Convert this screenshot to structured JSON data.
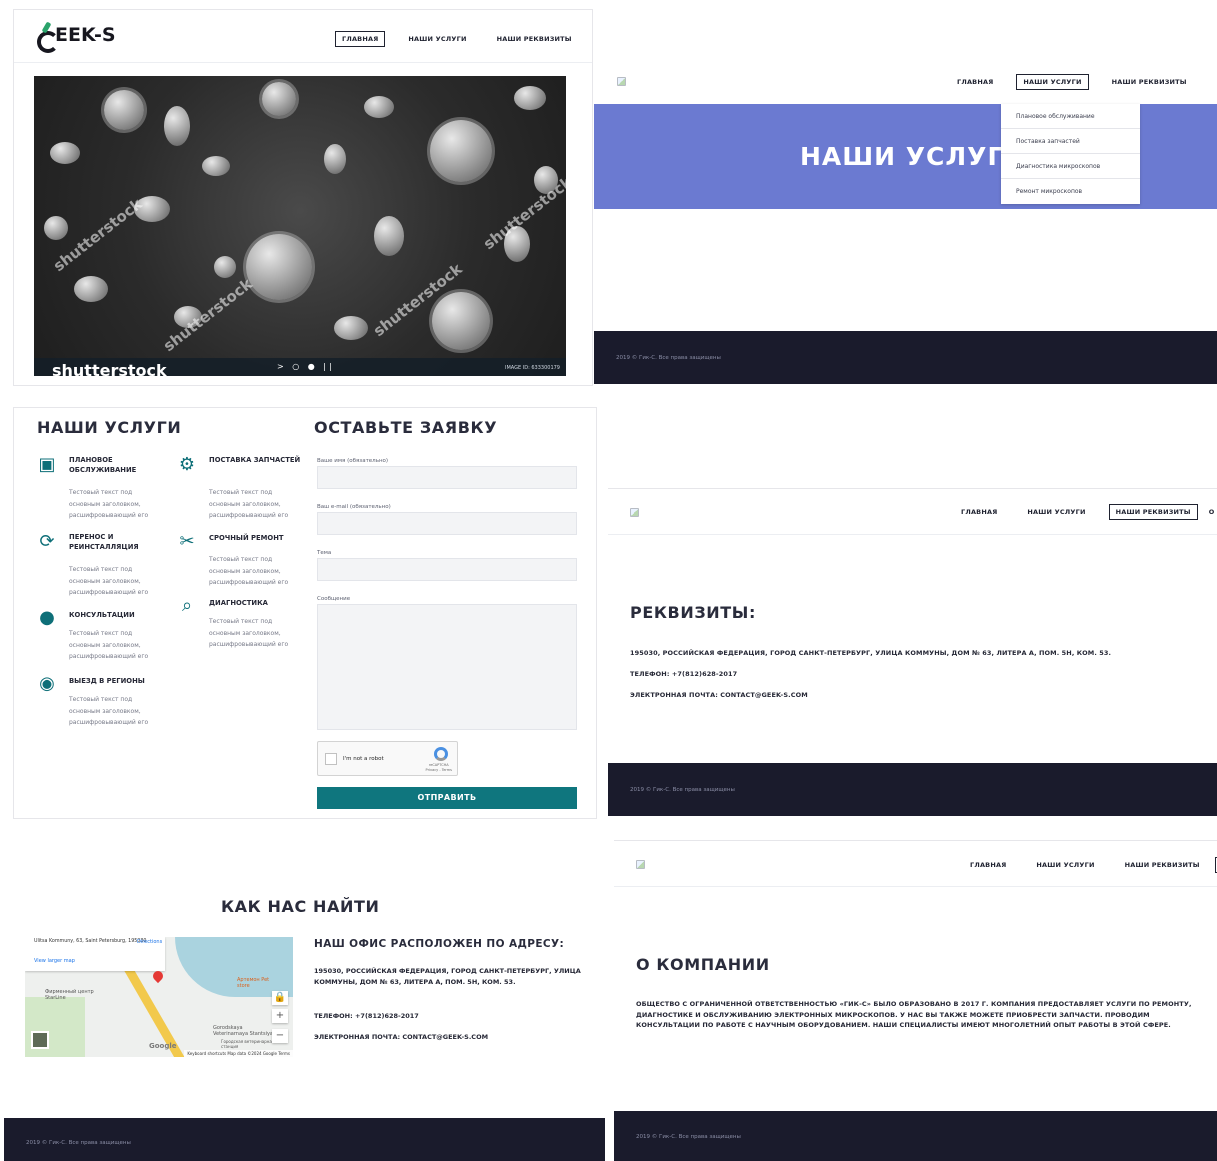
{
  "nav": {
    "home": "ГЛАВНАЯ",
    "services": "НАШИ УСЛУГИ",
    "requisites": "НАШИ РЕКВИЗИТЫ",
    "about": "О НАС"
  },
  "logo": {
    "text": "EEK-S"
  },
  "hero": {
    "watermark": "shutterstock",
    "image_id": "IMAGE ID: 633300179",
    "dots": "> ○ ● ||"
  },
  "services_page": {
    "banner_title": "НАШИ УСЛУГИ",
    "dropdown": [
      "Плановое обслуживание",
      "Поставка запчастей",
      "Диагностика микроскопов",
      "Ремонт микроскопов"
    ]
  },
  "footer": {
    "copyright": "2019 © Гик-С. Все права защищены"
  },
  "services_section": {
    "title": "НАШИ УСЛУГИ",
    "items": [
      {
        "title": "Плановое обслуживание",
        "icon": "calendar-icon",
        "desc": "Тестовый текст под основным заголовком, расшифровывающий его"
      },
      {
        "title": "Поставка запчастей",
        "icon": "gears-icon",
        "desc": "Тестовый текст под основным заголовком, расшифровывающий его"
      },
      {
        "title": "Перенос и реинсталляция",
        "icon": "sync-icon",
        "desc": "Тестовый текст под основным заголовком, расшифровывающий его"
      },
      {
        "title": "Срочный ремонт",
        "icon": "tools-icon",
        "desc": "Тестовый текст под основным заголовком, расшифровывающий его"
      },
      {
        "title": "Консультации",
        "icon": "users-icon",
        "desc": "Тестовый текст под основным заголовком, расшифровывающий его"
      },
      {
        "title": "Диагностика",
        "icon": "search-icon",
        "desc": "Тестовый текст под основным заголовком, расшифровывающий его"
      },
      {
        "title": "Выезд в регионы",
        "icon": "globe-icon",
        "desc": "Тестовый текст под основным заголовком, расшифровывающий его"
      }
    ]
  },
  "form": {
    "title": "ОСТАВЬТЕ ЗАЯВКУ",
    "name_label": "Ваше имя (обязательно)",
    "email_label": "Ваш e-mail (обязательно)",
    "subject_label": "Тема",
    "message_label": "Сообщение",
    "captcha_label": "I'm not a robot",
    "captcha_brand": "reCAPTCHA",
    "captcha_terms": "Privacy - Terms",
    "submit": "ОТПРАВИТЬ"
  },
  "requisites": {
    "title": "РЕКВИЗИТЫ:",
    "address": "195030, РОССИЙСКАЯ ФЕДЕРАЦИЯ, ГОРОД САНКТ-ПЕТЕРБУРГ, УЛИЦА КОММУНЫ, ДОМ № 63, ЛИТЕРА А, ПОМ. 5Н, КОМ. 53.",
    "phone": "ТЕЛЕФОН: +7(812)628-2017",
    "email": "ЭЛЕКТРОННАЯ ПОЧТА: CONTACT@GEEK-S.COM"
  },
  "contacts": {
    "title": "КАК НАС НАЙТИ",
    "office_title": "НАШ ОФИС РАСПОЛОЖЕН ПО АДРЕСУ:",
    "address": "195030, РОССИЙСКАЯ ФЕДЕРАЦИЯ, ГОРОД САНКТ-ПЕТЕРБУРГ, УЛИЦА КОММУНЫ, ДОМ № 63, ЛИТЕРА А, ПОМ. 5Н, КОМ. 53.",
    "phone": "ТЕЛЕФОН: +7(812)628-2017",
    "email": "ЭЛЕКТРОННАЯ ПОЧТА: CONTACT@GEEK-S.COM",
    "map": {
      "info": "Ulitsa Kommuny, 63, Saint Petersburg, 195030",
      "directions": "Directions",
      "larger": "View larger map",
      "label_1": "Фирменный центр StarLine",
      "label_2": "Артемон Pet store",
      "label_3": "Gorodskaya Veterinarnaya Stantsiya",
      "label_4": "Городская ветеринарная станция",
      "google": "Google",
      "attribution": "Keyboard shortcuts   Map data ©2024 Google   Terms"
    }
  },
  "about": {
    "title": "О КОМПАНИИ",
    "text": "ОБЩЕСТВО С ОГРАНИЧЕННОЙ ОТВЕТСТВЕННОСТЬЮ «ГИК-С» БЫЛО ОБРАЗОВАНО В 2017 Г. КОМПАНИЯ ПРЕДОСТАВЛЯЕТ УСЛУГИ ПО РЕМОНТУ, ДИАГНОСТИКЕ И ОБСЛУЖИВАНИЮ ЭЛЕКТРОННЫХ МИКРОСКОПОВ. У НАС ВЫ ТАКЖЕ МОЖЕТЕ ПРИОБРЕСТИ ЗАПЧАСТИ. ПРОВОДИМ КОНСУЛЬТАЦИИ ПО РАБОТЕ С НАУЧНЫМ ОБОРУДОВАНИЕМ. НАШИ СПЕЦИАЛИСТЫ ИМЕЮТ МНОГОЛЕТНИЙ ОПЫТ РАБОТЫ В ЭТОЙ СФЕРЕ."
  }
}
